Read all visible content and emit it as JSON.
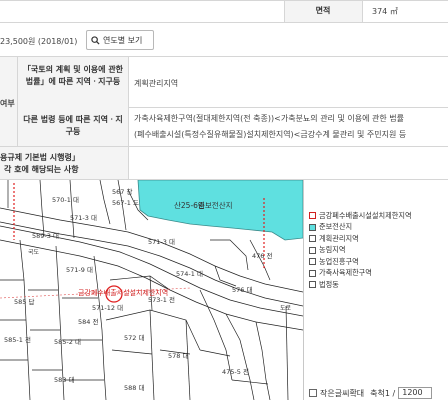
{
  "info_table": {
    "area_label": "면적",
    "area_value": "374 ㎡",
    "price_value": "23,500원 (2018/01)",
    "year_button_label": "연도별 보기",
    "left_header_fragment": "여부",
    "row1_label": "「국토의 계획 및 이용에 관한 법률」에 따른 지역ㆍ지구등",
    "row1_value": "계획관리지역",
    "row2_label": "다른 법령 등에 따른 지역ㆍ지구등",
    "row2_value_line1": "가축사육제한구역(절대제한지역(전 축종))<가축분뇨의 관리 및 이용에 관한 법률",
    "row2_value_line2": "(폐수배출시설(특정수질유해물질)설치제한지역)<금강수계 물관리 및 주민지원 등",
    "row3_label_line1": "용규제 기본법 시행령」",
    "row3_label_line2": "각 호에 해당되는 사항"
  },
  "map": {
    "area_labels": {
      "forest": "산25-6임",
      "forest_sub": "준보전산지",
      "red_zone": "금강폐수배출시설설치제한지역"
    },
    "parcels": [
      "567 창",
      "567-1 도",
      "570-1 대",
      "571-3 대",
      "571-3 대",
      "589-3 대",
      "571-9 대",
      "574-1 대",
      "476 전",
      "585 답",
      "571-12 대",
      "573-1 전",
      "576 대",
      "585-1 전",
      "572 대",
      "584 전",
      "585-2 대",
      "578 대",
      "475-5 전",
      "583 대",
      "588 대"
    ],
    "road_labels": [
      "국도",
      "도로"
    ]
  },
  "legend": {
    "items": [
      {
        "label": "금강폐수배출시설설치제한지역",
        "color": "#ffffff",
        "border": "#d02020"
      },
      {
        "label": "준보전산지",
        "color": "#5fe0e0",
        "border": "#555555"
      },
      {
        "label": "계획관리지역",
        "color": "#ffffff",
        "border": "#555555"
      },
      {
        "label": "농림지역",
        "color": "#ffffff",
        "border": "#555555"
      },
      {
        "label": "농업진흥구역",
        "color": "#ffffff",
        "border": "#555555"
      },
      {
        "label": "가축사육제한구역",
        "color": "#ffffff",
        "border": "#555555"
      },
      {
        "label": "법정동",
        "color": "#ffffff",
        "border": "#555555"
      }
    ]
  },
  "bottom_bar": {
    "zoom_label": "작은글씨확대",
    "scale_label": "축척1 /",
    "scale_value": "1200"
  }
}
